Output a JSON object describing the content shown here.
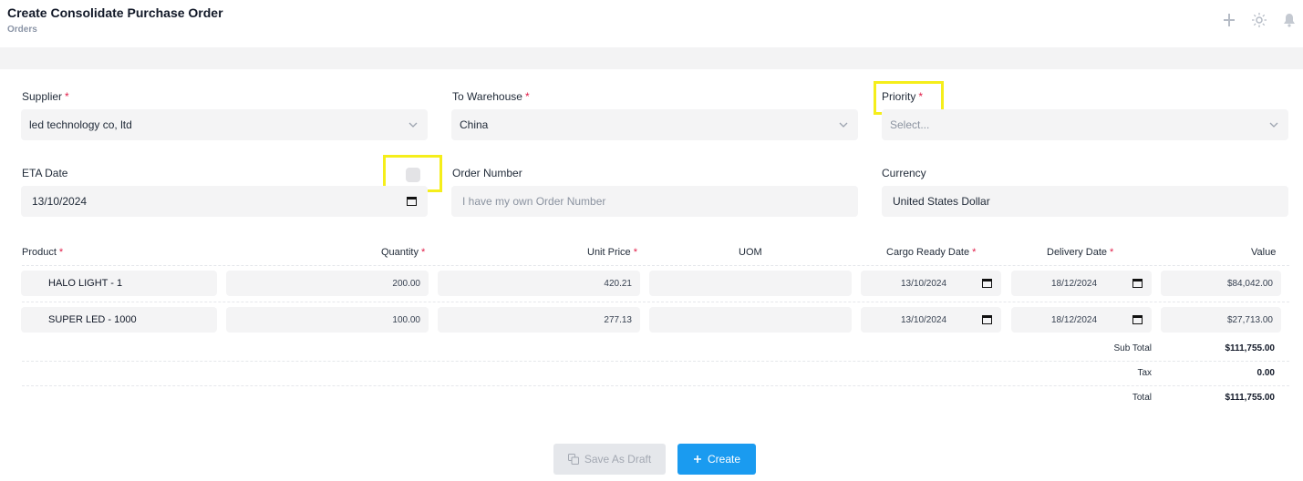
{
  "header": {
    "title": "Create Consolidate Purchase Order",
    "breadcrumb": "Orders",
    "icons": [
      "plus-icon",
      "sun-icon",
      "bell-icon"
    ]
  },
  "form": {
    "supplier": {
      "label": "Supplier",
      "value": "led technology co, ltd"
    },
    "warehouse": {
      "label": "To Warehouse",
      "value": "China"
    },
    "priority": {
      "label": "Priority",
      "placeholder": "Select..."
    },
    "eta": {
      "label": "ETA Date",
      "value": "13/10/2024",
      "checkbox_checked": false
    },
    "order_number": {
      "label": "Order Number",
      "placeholder": "I have my own Order Number"
    },
    "currency": {
      "label": "Currency",
      "value": "United States Dollar"
    },
    "required_mark": "*"
  },
  "table": {
    "headers": {
      "product": "Product",
      "quantity": "Quantity",
      "unit_price": "Unit Price",
      "uom": "UOM",
      "cargo_ready": "Cargo Ready Date",
      "delivery": "Delivery Date",
      "value": "Value"
    },
    "rows": [
      {
        "product": "HALO LIGHT - 1",
        "quantity": "200.00",
        "unit_price": "420.21",
        "uom": "",
        "cargo_ready": "13/10/2024",
        "delivery": "18/12/2024",
        "value": "$84,042.00"
      },
      {
        "product": "SUPER LED - 1000",
        "quantity": "100.00",
        "unit_price": "277.13",
        "uom": "",
        "cargo_ready": "13/10/2024",
        "delivery": "18/12/2024",
        "value": "$27,713.00"
      }
    ],
    "totals": {
      "subtotal_label": "Sub Total",
      "subtotal": "$111,755.00",
      "tax_label": "Tax",
      "tax": "0.00",
      "total_label": "Total",
      "total": "$111,755.00"
    }
  },
  "buttons": {
    "draft": "Save As Draft",
    "create": "Create"
  },
  "colors": {
    "accent": "#1a9bf0",
    "highlight": "#f5ee1b",
    "required": "#e11d48"
  }
}
